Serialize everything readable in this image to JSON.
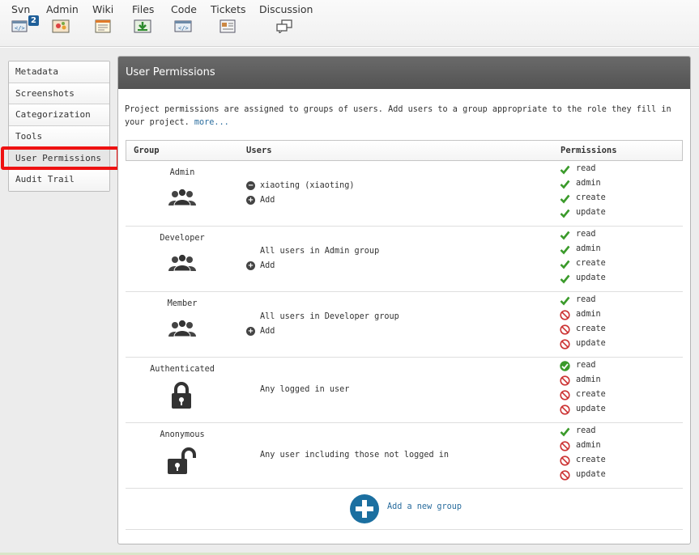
{
  "toolbar": {
    "tools": [
      {
        "label": "Svn",
        "icon": "svn-icon",
        "badge": "2"
      },
      {
        "label": "Admin",
        "icon": "admin-icon"
      },
      {
        "label": "Wiki",
        "icon": "wiki-icon"
      },
      {
        "label": "Files",
        "icon": "files-download-icon"
      },
      {
        "label": "Code",
        "icon": "code-icon"
      },
      {
        "label": "Tickets",
        "icon": "tickets-icon"
      },
      {
        "label": "Discussion",
        "icon": "discussion-icon"
      }
    ]
  },
  "sidebar": {
    "items": [
      {
        "label": "Metadata"
      },
      {
        "label": "Screenshots"
      },
      {
        "label": "Categorization"
      },
      {
        "label": "Tools"
      },
      {
        "label": "User Permissions"
      },
      {
        "label": "Audit Trail"
      }
    ],
    "active_index": 4,
    "highlight_color": "#ee1111"
  },
  "panel": {
    "title": "User Permissions",
    "intro_text": "Project permissions are assigned to groups of users. Add users to a group appropriate to the role they fill in your project.",
    "more_link": "more...",
    "columns": {
      "group": "Group",
      "users": "Users",
      "permissions": "Permissions"
    },
    "groups": [
      {
        "name": "Admin",
        "icon": "users-group-icon",
        "users": [
          {
            "type": "remove",
            "text": "xiaoting (xiaoting)"
          },
          {
            "type": "add",
            "text": "Add"
          }
        ],
        "permissions": [
          {
            "label": "read",
            "state": "granted"
          },
          {
            "label": "admin",
            "state": "granted"
          },
          {
            "label": "create",
            "state": "granted"
          },
          {
            "label": "update",
            "state": "granted"
          }
        ]
      },
      {
        "name": "Developer",
        "icon": "users-group-icon",
        "users": [
          {
            "type": "text",
            "text": "All users in Admin group"
          },
          {
            "type": "add",
            "text": "Add"
          }
        ],
        "permissions": [
          {
            "label": "read",
            "state": "granted"
          },
          {
            "label": "admin",
            "state": "granted"
          },
          {
            "label": "create",
            "state": "granted"
          },
          {
            "label": "update",
            "state": "granted"
          }
        ]
      },
      {
        "name": "Member",
        "icon": "users-group-icon",
        "users": [
          {
            "type": "text",
            "text": "All users in Developer group"
          },
          {
            "type": "add",
            "text": "Add"
          }
        ],
        "permissions": [
          {
            "label": "read",
            "state": "granted"
          },
          {
            "label": "admin",
            "state": "denied"
          },
          {
            "label": "create",
            "state": "denied"
          },
          {
            "label": "update",
            "state": "denied"
          }
        ]
      },
      {
        "name": "Authenticated",
        "icon": "padlock-locked-icon",
        "users": [
          {
            "type": "text",
            "text": "Any logged in user"
          }
        ],
        "permissions": [
          {
            "label": "read",
            "state": "granted-circle"
          },
          {
            "label": "admin",
            "state": "denied"
          },
          {
            "label": "create",
            "state": "denied"
          },
          {
            "label": "update",
            "state": "denied"
          }
        ]
      },
      {
        "name": "Anonymous",
        "icon": "padlock-unlocked-icon",
        "users": [
          {
            "type": "text",
            "text": "Any user including those not logged in"
          }
        ],
        "permissions": [
          {
            "label": "read",
            "state": "granted"
          },
          {
            "label": "admin",
            "state": "denied"
          },
          {
            "label": "create",
            "state": "denied"
          },
          {
            "label": "update",
            "state": "denied"
          }
        ]
      }
    ],
    "add_group_label": "Add a new group"
  },
  "colors": {
    "granted": "#3a9a2a",
    "denied": "#cc3333",
    "link": "#2a6d9e",
    "header_bg": "#5e5e5e",
    "add_button": "#1b6fa0"
  }
}
